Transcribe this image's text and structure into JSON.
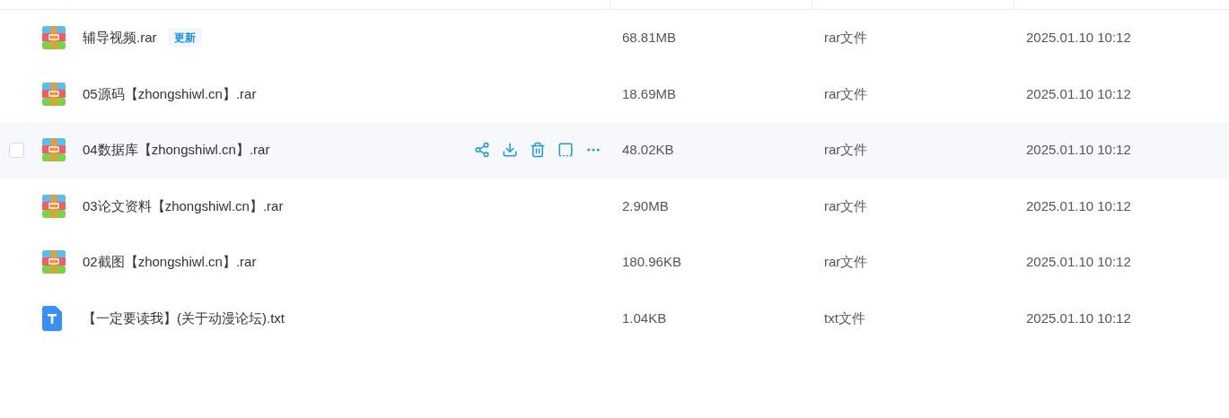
{
  "rows": [
    {
      "kind": "rar",
      "name": "辅导视频.rar",
      "badge": "更新",
      "size": "68.81MB",
      "type": "rar文件",
      "date": "2025.01.10 10:12",
      "hovered": false
    },
    {
      "kind": "rar",
      "name": "05源码【zhongshiwl.cn】.rar",
      "size": "18.69MB",
      "type": "rar文件",
      "date": "2025.01.10 10:12",
      "hovered": false
    },
    {
      "kind": "rar",
      "name": "04数据库【zhongshiwl.cn】.rar",
      "size": "48.02KB",
      "type": "rar文件",
      "date": "2025.01.10 10:12",
      "hovered": true,
      "checked": false
    },
    {
      "kind": "rar",
      "name": "03论文资料【zhongshiwl.cn】.rar",
      "size": "2.90MB",
      "type": "rar文件",
      "date": "2025.01.10 10:12",
      "hovered": false
    },
    {
      "kind": "rar",
      "name": "02截图【zhongshiwl.cn】.rar",
      "size": "180.96KB",
      "type": "rar文件",
      "date": "2025.01.10 10:12",
      "hovered": false
    },
    {
      "kind": "txt",
      "name": "【一定要读我】(关于动漫论坛).txt",
      "size": "1.04KB",
      "type": "txt文件",
      "date": "2025.01.10 10:12",
      "hovered": false
    }
  ]
}
